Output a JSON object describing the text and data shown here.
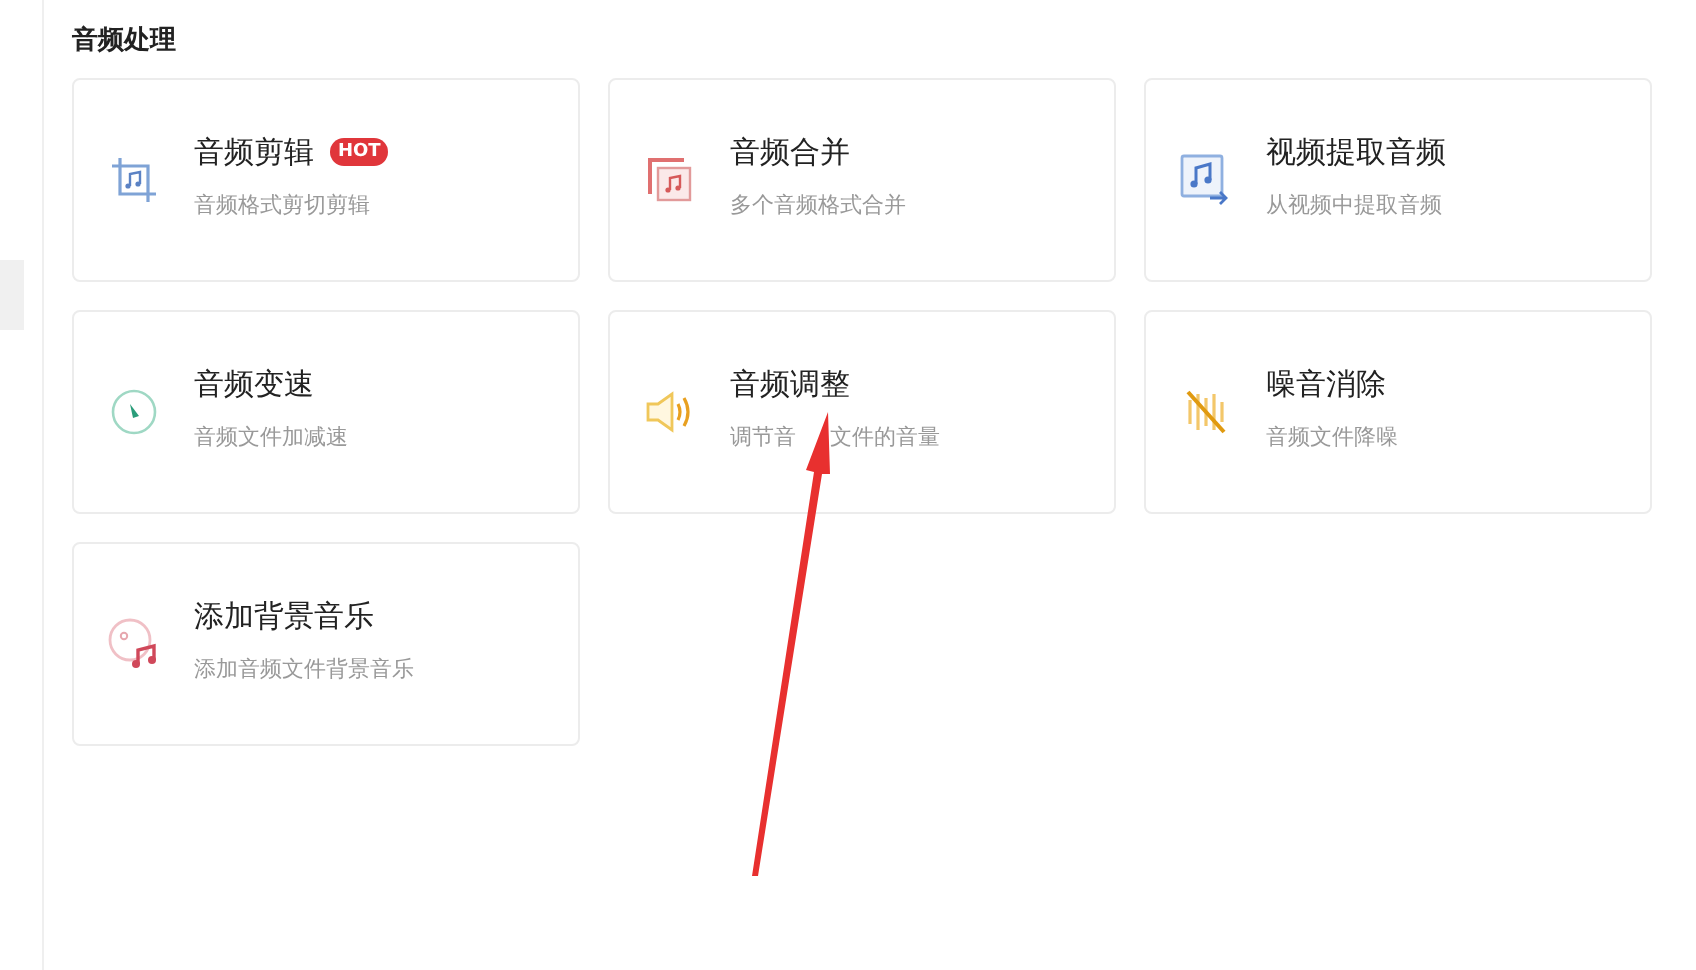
{
  "section": {
    "title": "音频处理"
  },
  "cards": [
    {
      "kind": "crop",
      "title": "音频剪辑",
      "badge": "HOT",
      "subtitle": "音频格式剪切剪辑"
    },
    {
      "kind": "merge",
      "title": "音频合并",
      "subtitle": "多个音频格式合并"
    },
    {
      "kind": "extract",
      "title": "视频提取音频",
      "subtitle": "从视频中提取音频"
    },
    {
      "kind": "speed",
      "title": "音频变速",
      "subtitle": "音频文件加减速"
    },
    {
      "kind": "volume",
      "title": "音频调整",
      "subtitle_parts": [
        "调节音",
        "文件的音量"
      ]
    },
    {
      "kind": "noise",
      "title": "噪音消除",
      "subtitle": "音频文件降噪"
    },
    {
      "kind": "bgm",
      "title": "添加背景音乐",
      "subtitle": "添加音频文件背景音乐"
    }
  ],
  "annotation": {
    "kind": "arrow"
  }
}
